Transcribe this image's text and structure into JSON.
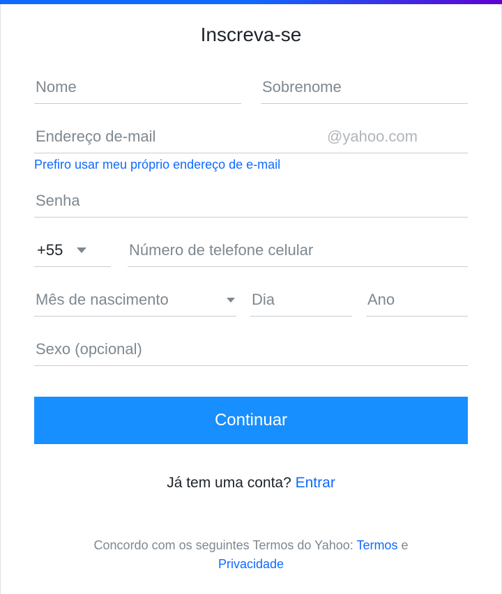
{
  "title": "Inscreva-se",
  "fields": {
    "first_name_ph": "Nome",
    "last_name_ph": "Sobrenome",
    "email_ph": "Endereço de-mail",
    "email_suffix": "@yahoo.com",
    "own_email_link": "Prefiro usar meu próprio endereço de e-mail",
    "password_ph": "Senha",
    "country_code": "+55",
    "phone_ph": "Número de telefone celular",
    "birth_month_ph": "Mês de nascimento",
    "birth_day_ph": "Dia",
    "birth_year_ph": "Ano",
    "gender_ph": "Sexo (opcional)"
  },
  "buttons": {
    "continue": "Continuar"
  },
  "signin": {
    "prompt": "Já tem uma conta? ",
    "link": "Entrar"
  },
  "terms": {
    "prefix": "Concordo com os seguintes Termos do Yahoo: ",
    "terms_link": "Termos",
    "and": " e ",
    "privacy_link": "Privacidade"
  }
}
